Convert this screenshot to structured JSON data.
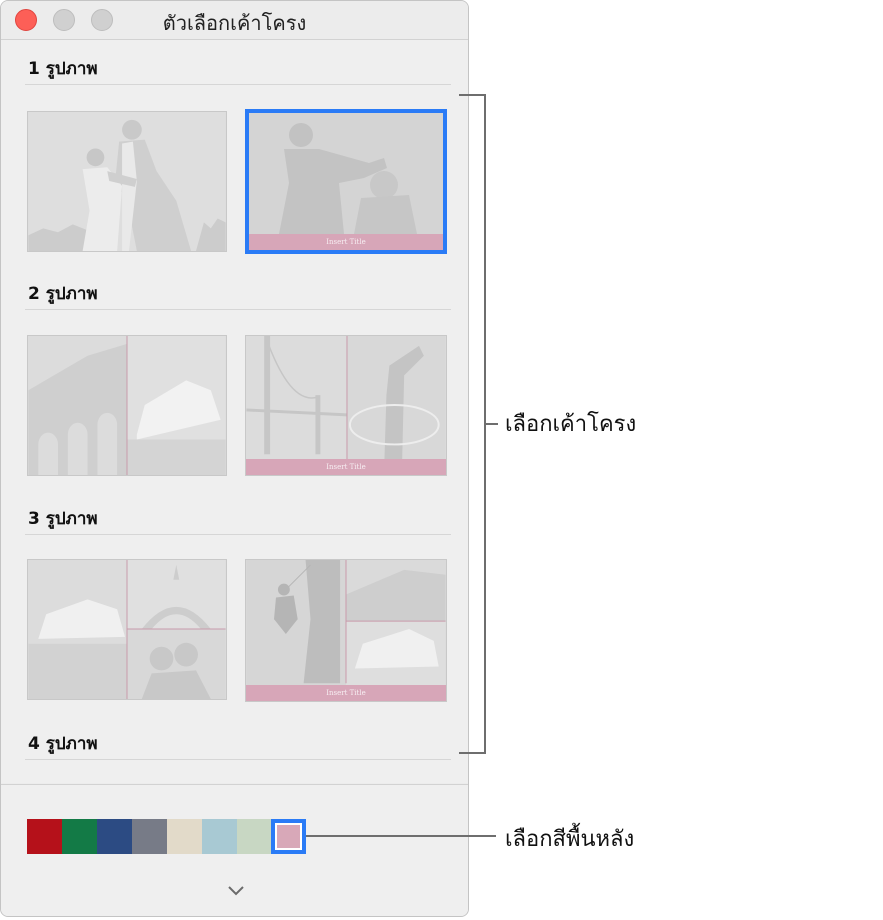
{
  "window": {
    "title": "ตัวเลือกเค้าโครง"
  },
  "sections": [
    {
      "title": "1 รูปภาพ"
    },
    {
      "title": "2 รูปภาพ"
    },
    {
      "title": "3 รูปภาพ"
    },
    {
      "title": "4 รูปภาพ"
    }
  ],
  "thumbnail_caption": "Insert Title",
  "selected_layout": "1 รูปภาพ — with title",
  "swatches": [
    {
      "color": "#b5111a"
    },
    {
      "color": "#137a46"
    },
    {
      "color": "#2c4b83"
    },
    {
      "color": "#777b87"
    },
    {
      "color": "#e2dac9"
    },
    {
      "color": "#a8c9d3"
    },
    {
      "color": "#c8d7c3"
    },
    {
      "color": "#d8a8b8",
      "selected": true
    }
  ],
  "annotations": {
    "layout": "เลือกเค้าโครง",
    "background": "เลือกสีพื้นหลัง"
  },
  "accent_color": "#2a7bf6",
  "icons": [
    "close-button",
    "minimize-button",
    "zoom-button",
    "chevron-down-icon"
  ]
}
